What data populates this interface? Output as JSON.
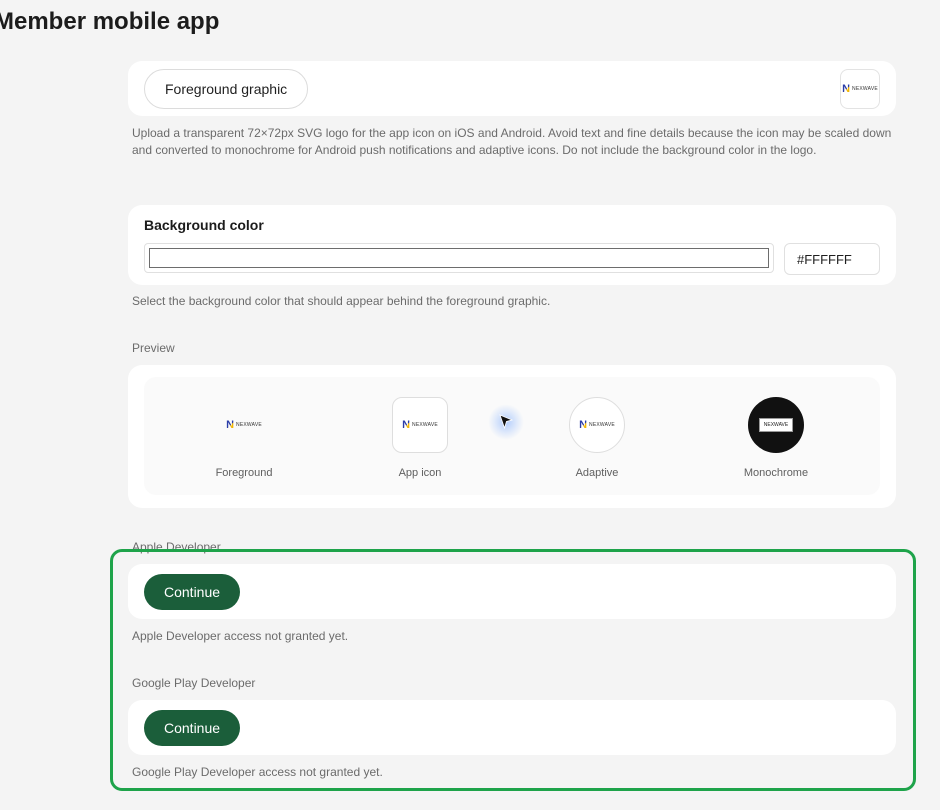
{
  "page": {
    "title": "Member mobile app"
  },
  "foreground": {
    "button_label": "Foreground graphic",
    "logo_text": "NEXWAVE",
    "helper": "Upload a transparent 72×72px SVG logo for the app icon on iOS and Android. Avoid text and fine details because the icon may be scaled down and converted to monochrome for Android push notifications and adaptive icons. Do not include the background color in the logo."
  },
  "background_color": {
    "heading": "Background color",
    "hex_value": "#FFFFFF",
    "helper": "Select the background color that should appear behind the foreground graphic."
  },
  "preview": {
    "label": "Preview",
    "items": [
      {
        "label": "Foreground"
      },
      {
        "label": "App icon"
      },
      {
        "label": "Adaptive"
      },
      {
        "label": "Monochrome"
      }
    ]
  },
  "apple": {
    "label": "Apple Developer",
    "button_label": "Continue",
    "status": "Apple Developer access not granted yet."
  },
  "google": {
    "label": "Google Play Developer",
    "button_label": "Continue",
    "status": "Google Play Developer access not granted yet."
  },
  "colors": {
    "accent_green": "#1b5e3a",
    "highlight_border": "#1ea34a",
    "logo_blue": "#2b3da8",
    "logo_yellow": "#f2b705"
  }
}
